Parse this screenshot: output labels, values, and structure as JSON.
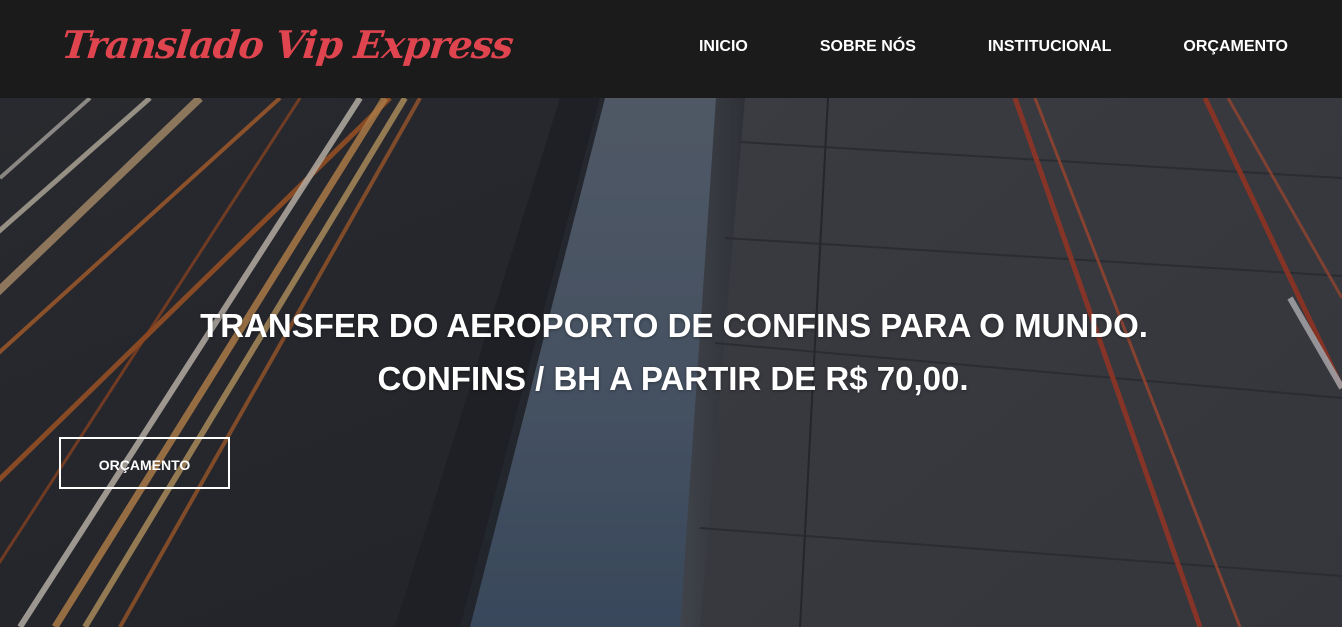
{
  "header": {
    "logo_text": "Translado Vip Express",
    "nav": [
      {
        "label": "INICIO"
      },
      {
        "label": "SOBRE NÓS"
      },
      {
        "label": "INSTITUCIONAL"
      },
      {
        "label": "ORÇAMENTO"
      }
    ]
  },
  "hero": {
    "title_line1": "TRANSFER DO AEROPORTO DE CONFINS PARA O MUNDO.",
    "title_line2": "CONFINS / BH A PARTIR DE R$ 70,00.",
    "cta_label": "ORÇAMENTO",
    "background": "highway-night-light-trails"
  },
  "colors": {
    "header_bg": "#1b1b1b",
    "logo": "#e0454f",
    "nav_text": "#ffffff",
    "hero_text": "#ffffff"
  }
}
